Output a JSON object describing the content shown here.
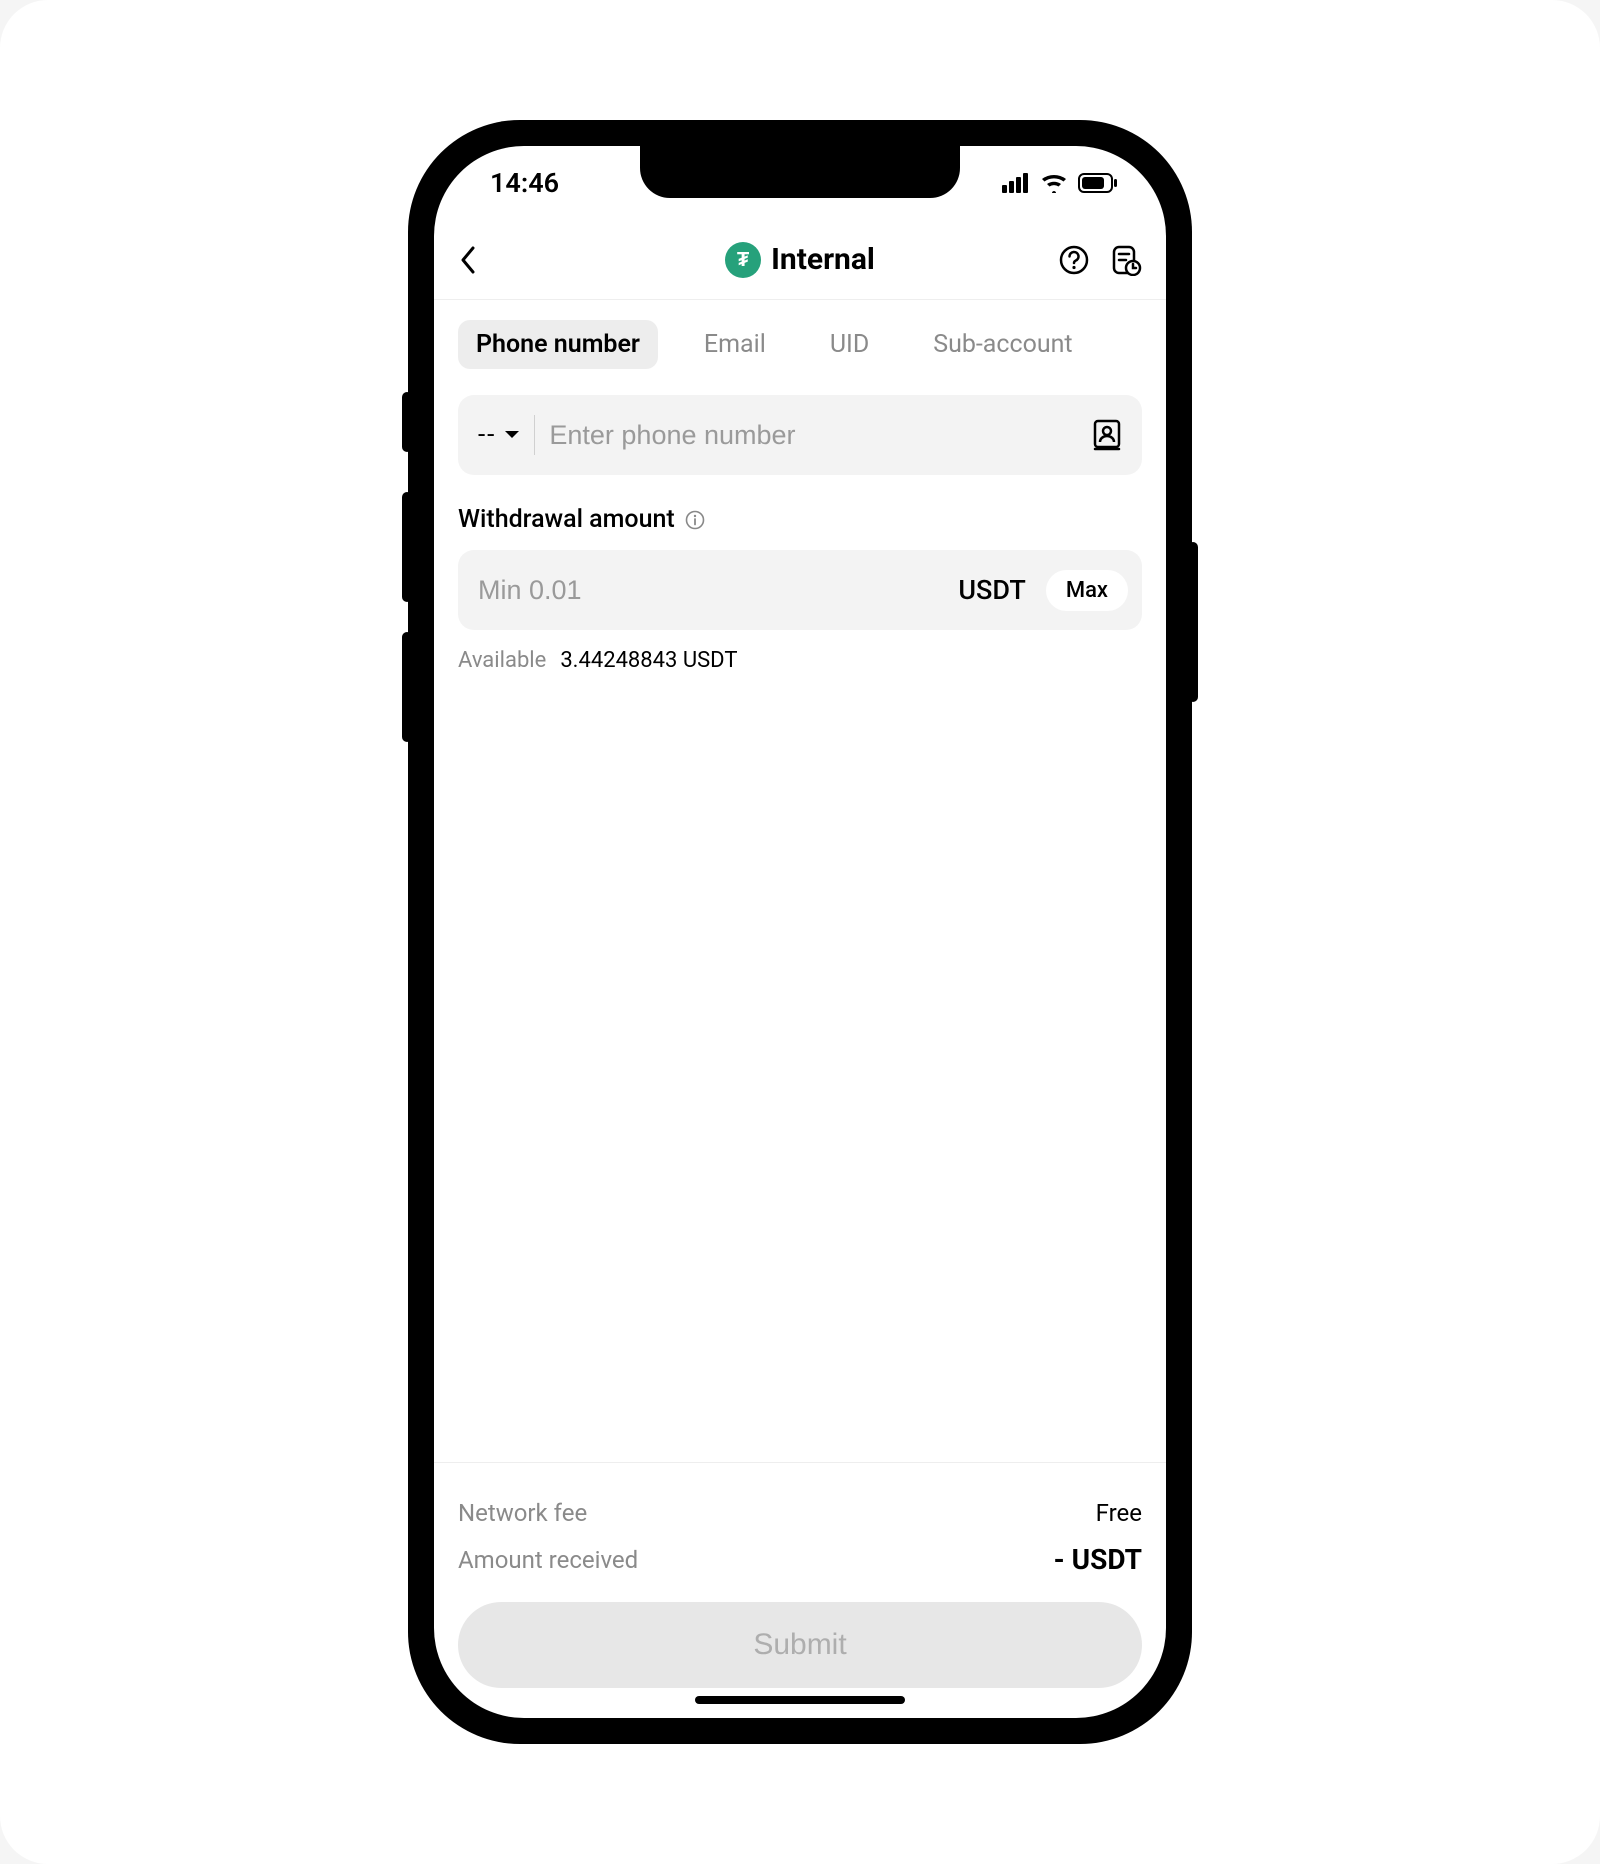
{
  "status": {
    "time": "14:46"
  },
  "nav": {
    "title": "Internal",
    "coin_symbol": "₮"
  },
  "tabs": {
    "phone": "Phone number",
    "email": "Email",
    "uid": "UID",
    "sub": "Sub-account"
  },
  "phone_field": {
    "country_code": "--",
    "placeholder": "Enter phone number"
  },
  "amount": {
    "label": "Withdrawal amount",
    "placeholder": "Min 0.01",
    "unit": "USDT",
    "max_label": "Max"
  },
  "available": {
    "label": "Available",
    "value": "3.44248843 USDT"
  },
  "footer": {
    "fee_label": "Network fee",
    "fee_value": "Free",
    "recv_label": "Amount received",
    "recv_value": "- USDT",
    "submit": "Submit"
  }
}
